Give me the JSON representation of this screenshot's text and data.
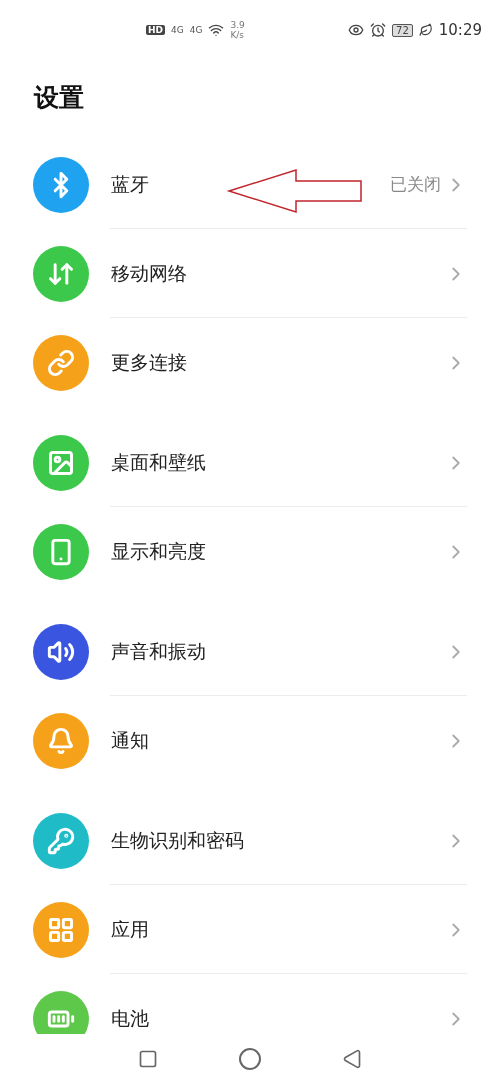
{
  "status_bar": {
    "hd": "HD",
    "network_1": "4G",
    "network_2": "4G",
    "speed_value": "3.9",
    "speed_unit": "K/s",
    "battery": "72",
    "time": "10:29"
  },
  "title": "设置",
  "groups": [
    {
      "items": [
        {
          "label": "蓝牙",
          "value": "已关闭",
          "color": "#1fa3f0"
        },
        {
          "label": "移动网络",
          "color": "#3cc84a"
        },
        {
          "label": "更多连接",
          "color": "#f5a21a"
        }
      ]
    },
    {
      "items": [
        {
          "label": "桌面和壁纸",
          "color": "#3cc84a"
        },
        {
          "label": "显示和亮度",
          "color": "#3cc84a"
        }
      ]
    },
    {
      "items": [
        {
          "label": "声音和振动",
          "color": "#3a56e0"
        },
        {
          "label": "通知",
          "color": "#f5a21a"
        }
      ]
    },
    {
      "items": [
        {
          "label": "生物识别和密码",
          "color": "#1fbcc8"
        },
        {
          "label": "应用",
          "color": "#f5a21a"
        },
        {
          "label": "电池",
          "color": "#5ec84a"
        }
      ]
    }
  ]
}
